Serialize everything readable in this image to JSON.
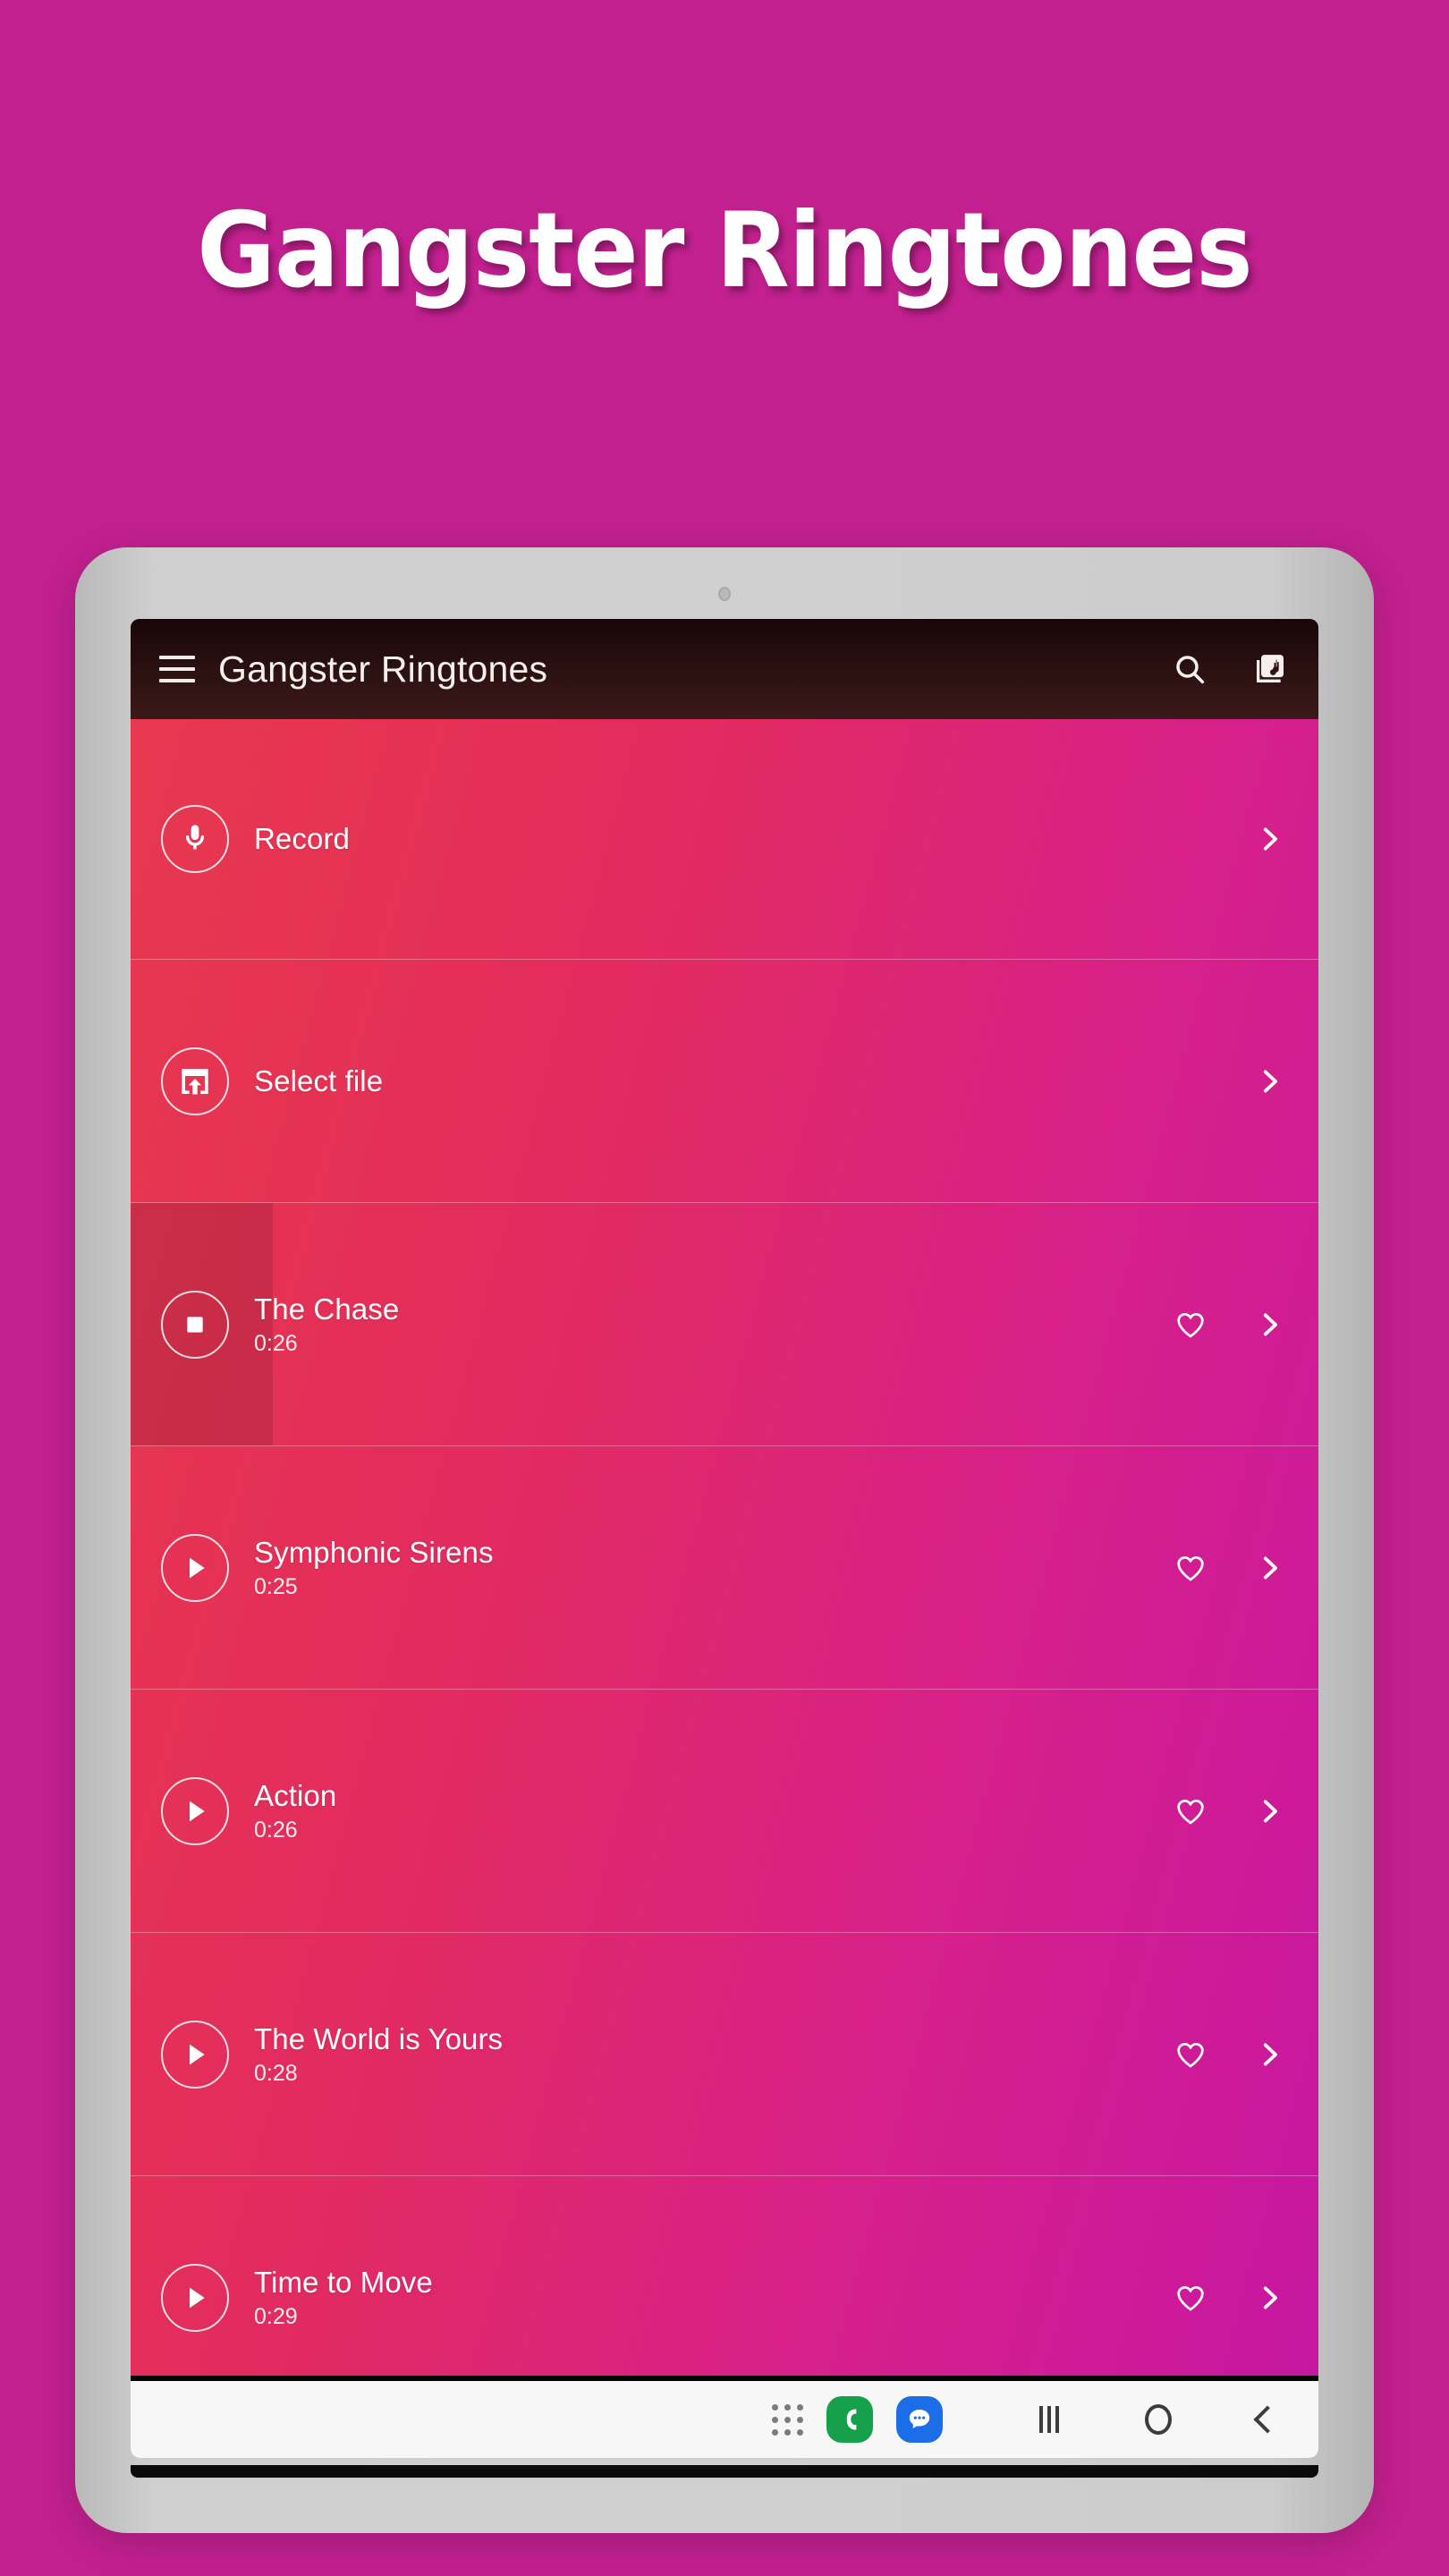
{
  "promo": {
    "headline": "Gangster Ringtones"
  },
  "appbar": {
    "title": "Gangster Ringtones",
    "menu_icon": "hamburger-menu-icon",
    "search_icon": "search-icon",
    "library_icon": "library-music-icon"
  },
  "list": {
    "rows": [
      {
        "label": "Record",
        "duration": "",
        "icon": "microphone-icon",
        "has_favorite": false,
        "state": "action"
      },
      {
        "label": "Select file",
        "duration": "",
        "icon": "open-in-browser-icon",
        "has_favorite": false,
        "state": "action"
      },
      {
        "label": "The Chase",
        "duration": "0:26",
        "icon": "stop-icon",
        "has_favorite": true,
        "state": "playing",
        "progress": "12%"
      },
      {
        "label": "Symphonic Sirens",
        "duration": "0:25",
        "icon": "play-icon",
        "has_favorite": true,
        "state": "idle"
      },
      {
        "label": "Action",
        "duration": "0:26",
        "icon": "play-icon",
        "has_favorite": true,
        "state": "idle"
      },
      {
        "label": "The World is Yours",
        "duration": "0:28",
        "icon": "play-icon",
        "has_favorite": true,
        "state": "idle"
      },
      {
        "label": "Time to Move",
        "duration": "0:29",
        "icon": "play-icon",
        "has_favorite": true,
        "state": "idle"
      }
    ]
  },
  "sysbar": {
    "app_drawer_icon": "apps-grid-icon",
    "phone_icon": "phone-icon",
    "messages_icon": "messages-icon",
    "recents_icon": "recents-icon",
    "home_icon": "home-icon",
    "back_icon": "back-icon"
  },
  "colors": {
    "background": "#c2208f",
    "appbar": "#2d1212",
    "list_start": "#e8384f",
    "list_end": "#c717a2",
    "phone_green": "#17a04a",
    "messages_blue": "#1c6ee8",
    "bezel": "#cfcfcf"
  }
}
